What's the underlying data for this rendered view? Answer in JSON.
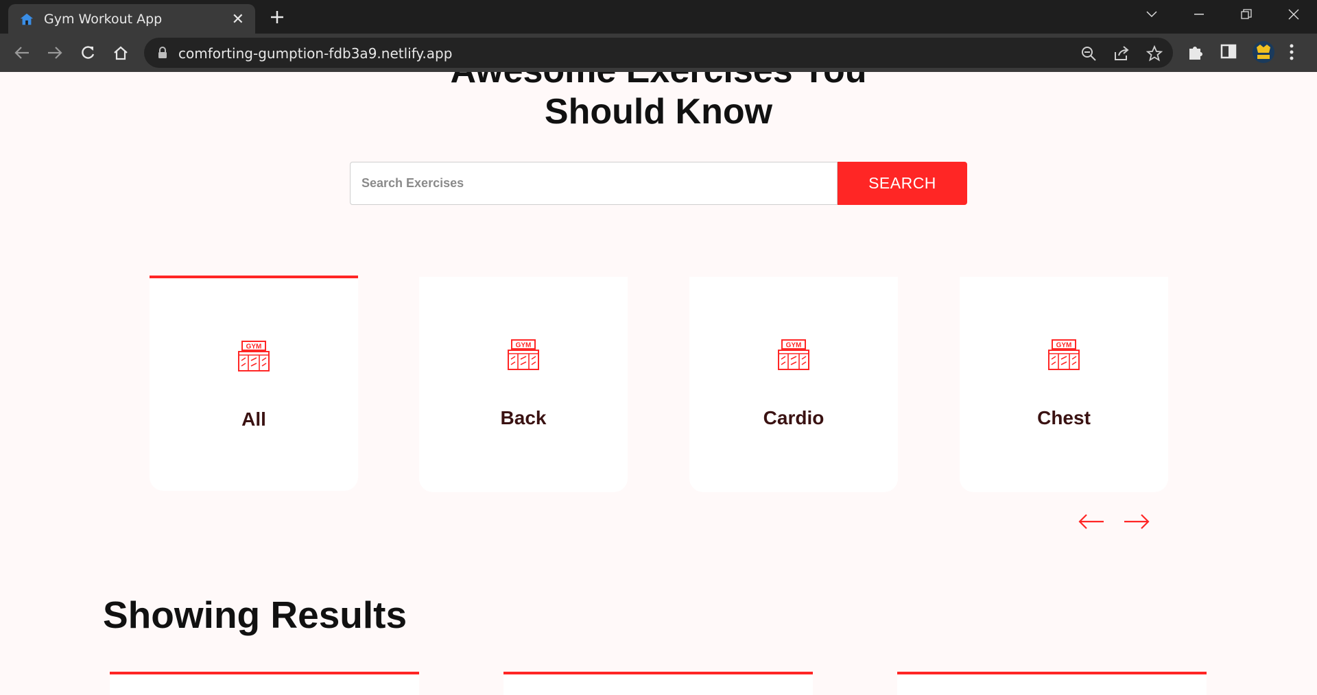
{
  "browser": {
    "tab_title": "Gym Workout App",
    "url": "comforting-gumption-fdb3a9.netlify.app"
  },
  "hero": {
    "partial_heading": "Awesome Exercises You",
    "heading": "Should Know"
  },
  "search": {
    "placeholder": "Search Exercises",
    "button_label": "SEARCH"
  },
  "categories": [
    {
      "label": "All",
      "active": true
    },
    {
      "label": "Back",
      "active": false
    },
    {
      "label": "Cardio",
      "active": false
    },
    {
      "label": "Chest",
      "active": false
    }
  ],
  "results": {
    "title": "Showing Results"
  },
  "colors": {
    "accent": "#ff2625",
    "page_bg": "#fff9f9",
    "card_label": "#3a1212"
  },
  "icons": {
    "category_icon": "gym-icon",
    "prev": "left-arrow-icon",
    "next": "right-arrow-icon"
  }
}
